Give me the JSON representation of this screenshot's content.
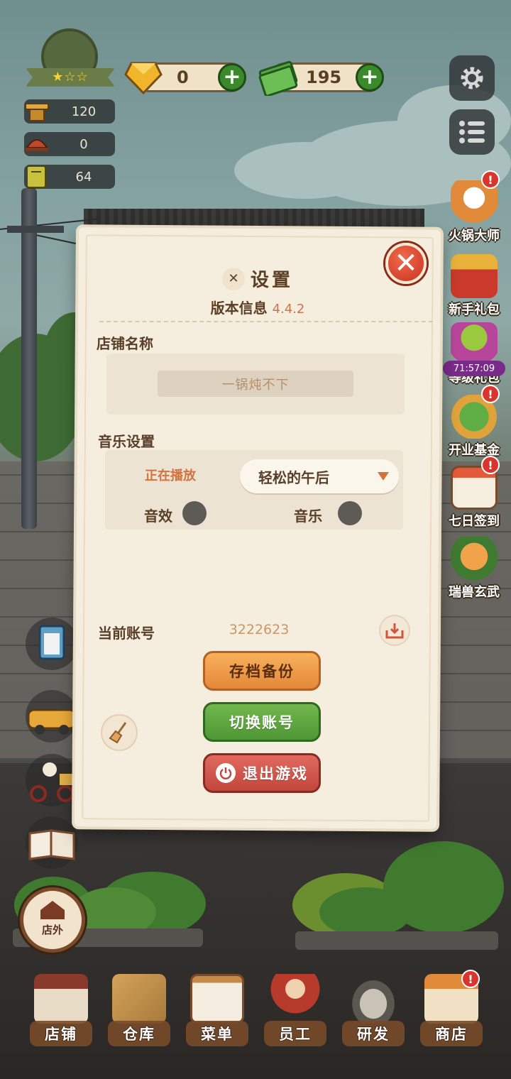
{
  "hud": {
    "gems": "0",
    "cash": "195",
    "stat_seats": "120",
    "stat_dishes": "0",
    "stat_reputation": "64"
  },
  "side_events": [
    {
      "label": "火锅大师",
      "alert": "!"
    },
    {
      "label": "新手礼包"
    },
    {
      "label": "等级礼包",
      "timer": "71:57:09"
    },
    {
      "label": "开业基金",
      "alert": "!"
    },
    {
      "label": "七日签到",
      "alert": "!"
    },
    {
      "label": "瑞兽玄武"
    }
  ],
  "dialog": {
    "title": "设置",
    "version_label": "版本信息",
    "version": "4.4.2",
    "shop_name_label": "店铺名称",
    "shop_name": "一锅炖不下",
    "music_section_label": "音乐设置",
    "now_playing_label": "正在播放",
    "now_playing": "轻松的午后",
    "sfx_label": "音效",
    "sfx_enabled": false,
    "music_label": "音乐",
    "music_enabled": false,
    "account_label": "当前账号",
    "account_id": "3222623",
    "backup_button": "存档备份",
    "switch_button": "切换账号",
    "exit_button": "退出游戏"
  },
  "bottom": {
    "outside_label": "店外",
    "nav": [
      {
        "label": "店铺"
      },
      {
        "label": "仓库"
      },
      {
        "label": "菜单"
      },
      {
        "label": "员工"
      },
      {
        "label": "研发"
      },
      {
        "label": "商店",
        "alert": "!"
      }
    ]
  },
  "colors": {
    "accent_orange": "#d3733e",
    "btn_orange": "#e4883a",
    "btn_green": "#4f9635",
    "btn_red": "#c2473d",
    "close_red": "#c83220"
  }
}
